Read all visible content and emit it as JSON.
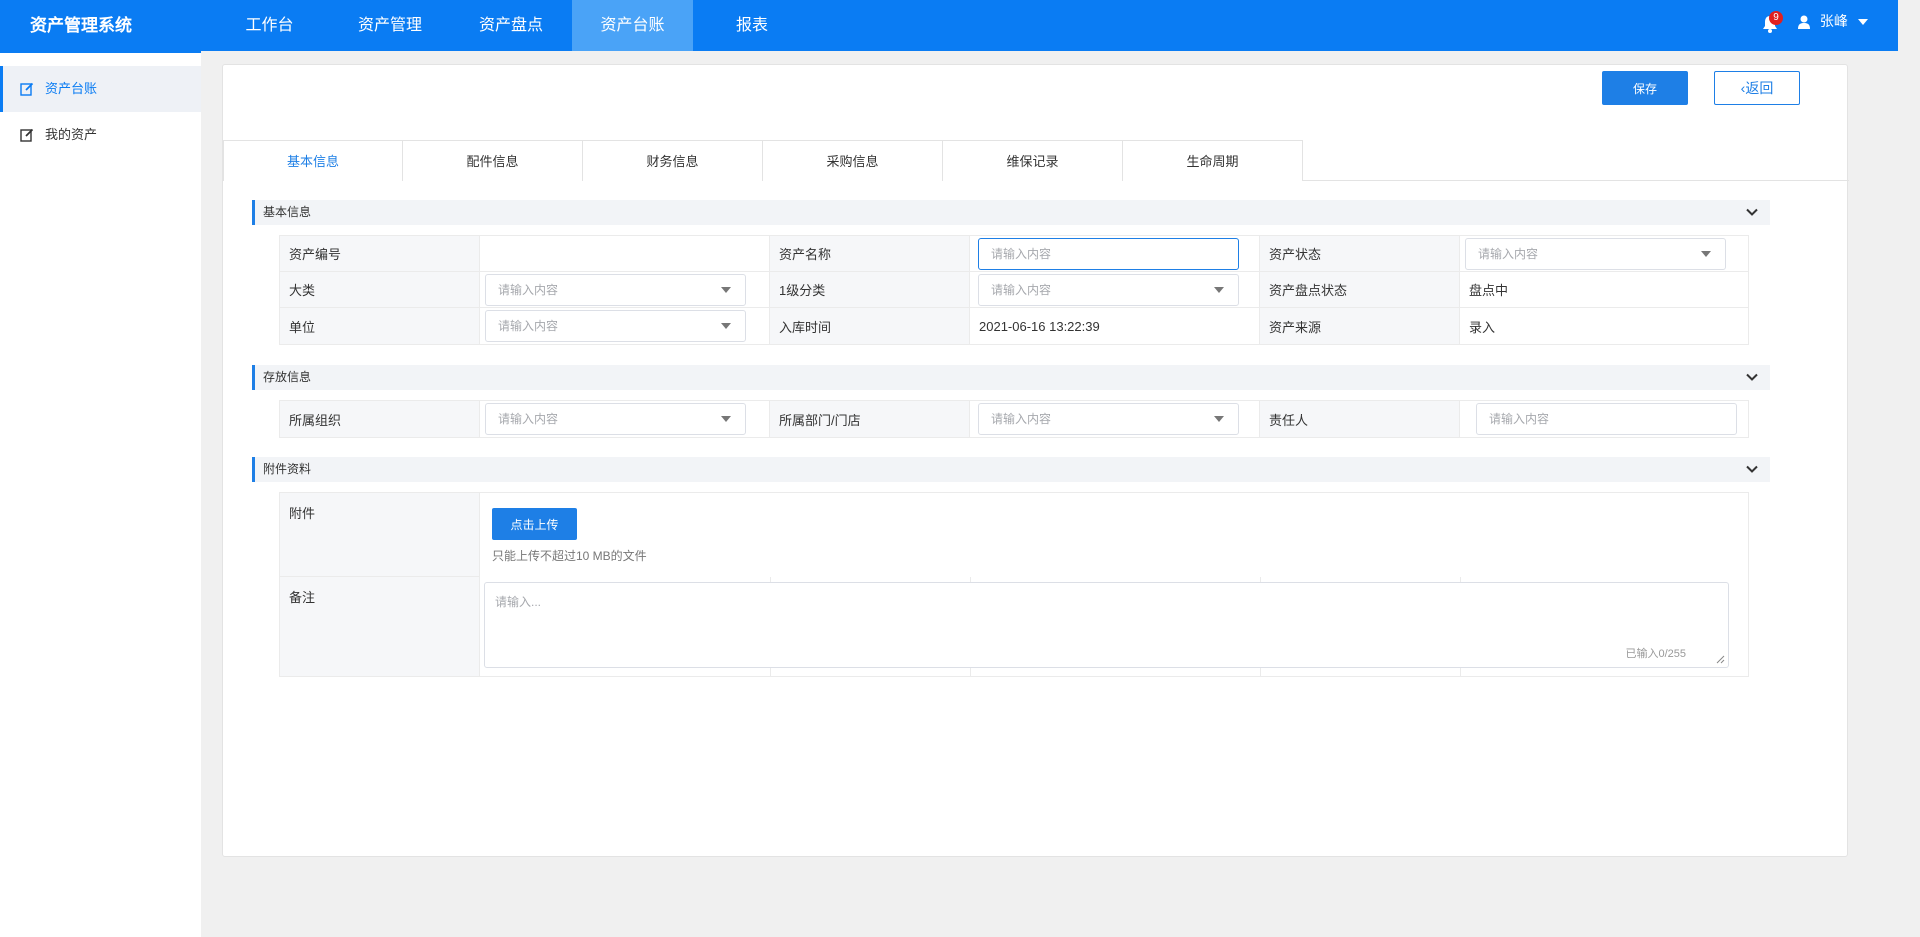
{
  "app": {
    "title": "资产管理系统"
  },
  "nav": {
    "items": [
      "工作台",
      "资产管理",
      "资产盘点",
      "资产台账",
      "报表"
    ],
    "active_index": 3
  },
  "notifications": {
    "count": "9"
  },
  "user": {
    "name": "张峰"
  },
  "sidebar": {
    "items": [
      {
        "label": "资产台账",
        "active": true
      },
      {
        "label": "我的资产",
        "active": false
      }
    ]
  },
  "actions": {
    "save": "保存",
    "back": "返回"
  },
  "tabs": {
    "items": [
      "基本信息",
      "配件信息",
      "财务信息",
      "采购信息",
      "维保记录",
      "生命周期"
    ],
    "active_index": 0
  },
  "sections": {
    "basic": {
      "title": "基本信息",
      "fields": {
        "asset_no": {
          "label": "资产编号",
          "value": ""
        },
        "asset_name": {
          "label": "资产名称",
          "placeholder": "请输入内容"
        },
        "asset_status": {
          "label": "资产状态",
          "placeholder": "请输入内容"
        },
        "category": {
          "label": "大类",
          "placeholder": "请输入内容"
        },
        "level1": {
          "label": "1级分类",
          "placeholder": "请输入内容"
        },
        "inventory_status": {
          "label": "资产盘点状态",
          "value": "盘点中"
        },
        "unit": {
          "label": "单位",
          "placeholder": "请输入内容"
        },
        "inbound_time": {
          "label": "入库时间",
          "value": "2021-06-16 13:22:39"
        },
        "source": {
          "label": "资产来源",
          "value": "录入"
        }
      }
    },
    "storage": {
      "title": "存放信息",
      "fields": {
        "org": {
          "label": "所属组织",
          "placeholder": "请输入内容"
        },
        "dept": {
          "label": "所属部门/门店",
          "placeholder": "请输入内容"
        },
        "owner": {
          "label": "责任人",
          "placeholder": "请输入内容"
        }
      }
    },
    "attachments": {
      "title": "附件资料",
      "attachment_label": "附件",
      "upload_button": "点击上传",
      "upload_tip": "只能上传不超过10 MB的文件",
      "remark_label": "备注",
      "remark_placeholder": "请输入...",
      "remark_count": "已输入0/255"
    }
  },
  "colors": {
    "primary": "#0a7cf3",
    "button": "#1e7fe6",
    "nav_active": "#4aa3f7"
  }
}
